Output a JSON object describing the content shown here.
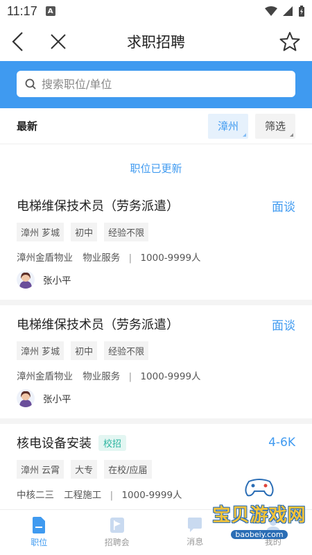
{
  "status_bar": {
    "time": "11:17",
    "notification_icon": "A"
  },
  "nav": {
    "title": "求职招聘"
  },
  "search": {
    "placeholder": "搜索职位/单位"
  },
  "filters": {
    "latest_label": "最新",
    "city": "漳州",
    "filter_label": "筛选"
  },
  "notice": "职位已更新",
  "jobs": [
    {
      "title": "电梯维保技术员（劳务派遣）",
      "salary": "面谈",
      "tags": [
        "漳州 芗城",
        "初中",
        "经验不限"
      ],
      "company": "漳州金盾物业",
      "industry": "物业服务",
      "size": "1000-9999人",
      "recruiter": "张小平"
    },
    {
      "title": "电梯维保技术员（劳务派遣）",
      "salary": "面谈",
      "tags": [
        "漳州 芗城",
        "初中",
        "经验不限"
      ],
      "company": "漳州金盾物业",
      "industry": "物业服务",
      "size": "1000-9999人",
      "recruiter": "张小平"
    },
    {
      "title": "核电设备安装",
      "badge": "校招",
      "salary": "4-6K",
      "tags": [
        "漳州 云霄",
        "大专",
        "在校/应届"
      ],
      "company": "中核二三",
      "industry": "工程施工",
      "size": "1000-9999人"
    }
  ],
  "tabs": [
    {
      "label": "职位",
      "icon": "document-icon",
      "active": true
    },
    {
      "label": "招聘会",
      "icon": "flag-icon",
      "active": false
    },
    {
      "label": "消息",
      "icon": "message-icon",
      "active": false
    },
    {
      "label": "我的",
      "icon": "user-icon",
      "active": false
    }
  ],
  "watermark": {
    "text": "宝贝游戏网",
    "url": "baobeiy.com"
  },
  "colors": {
    "accent": "#3f9af0",
    "school_tag": "#2cb5a0"
  }
}
